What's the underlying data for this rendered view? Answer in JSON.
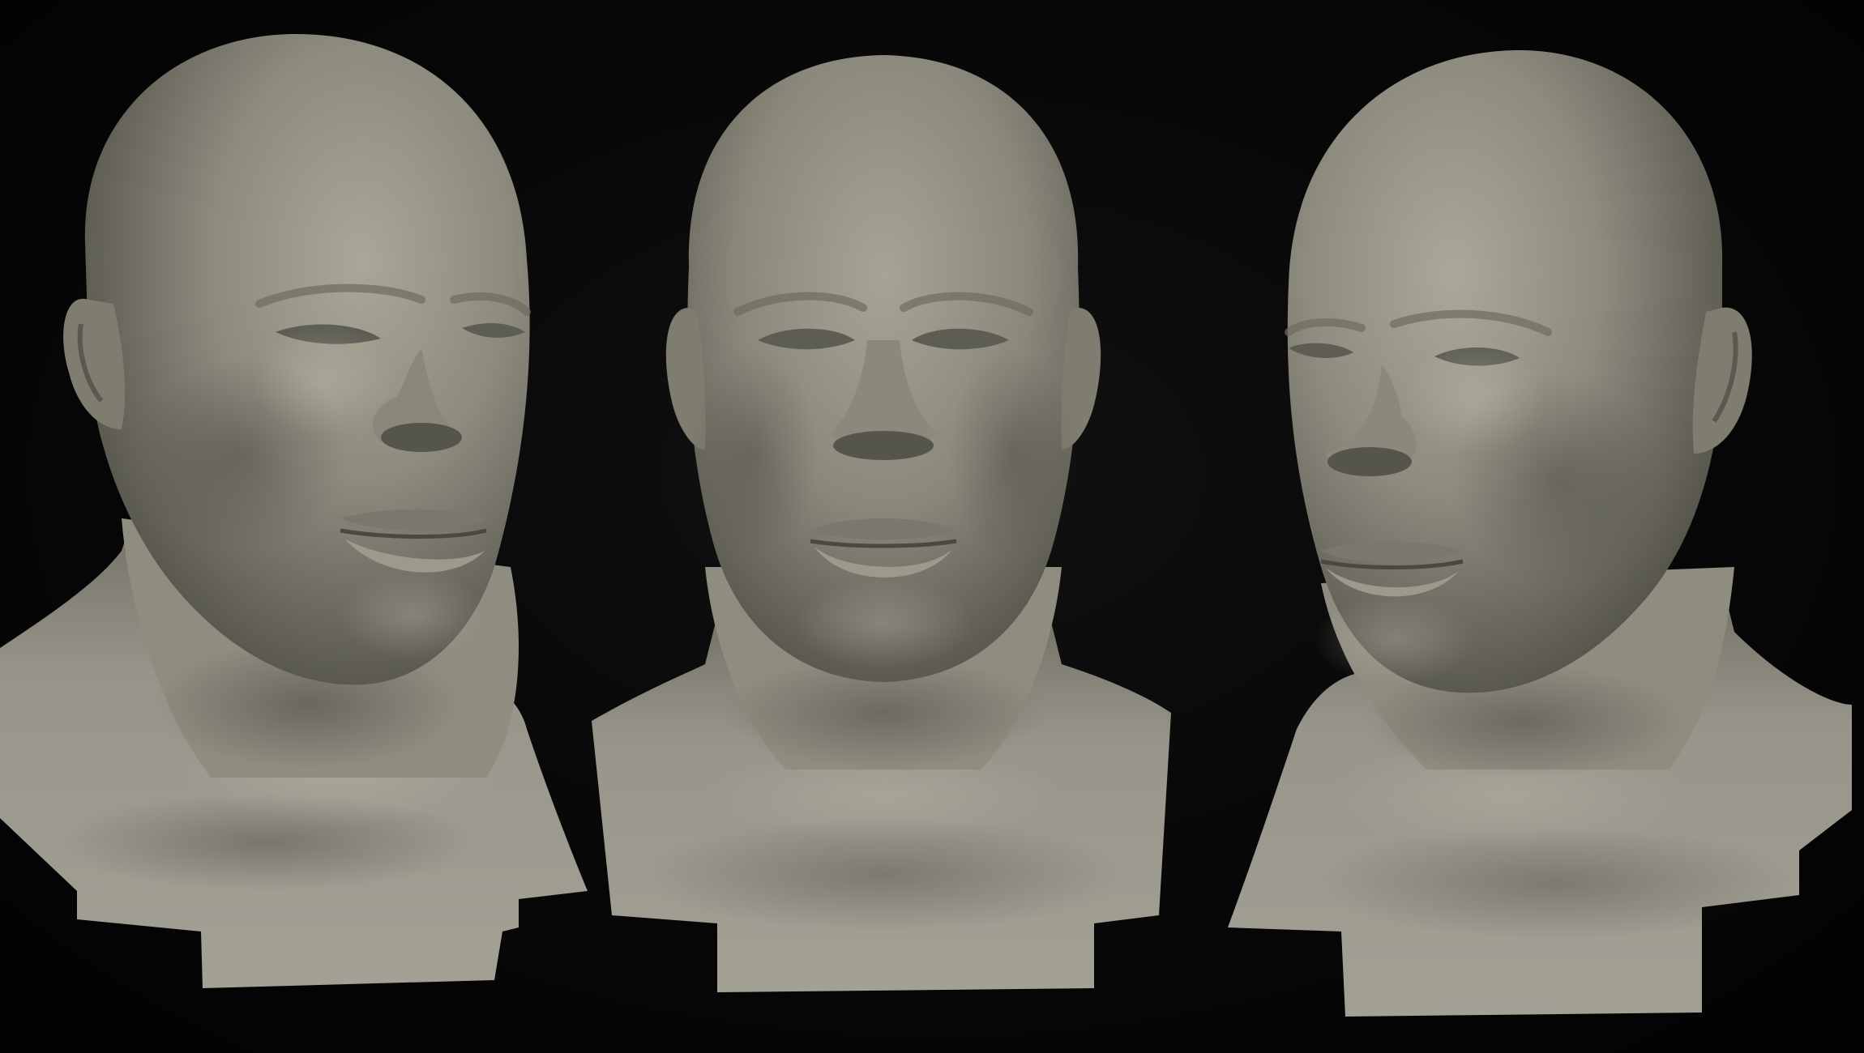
{
  "scene": {
    "background_color": "#050505",
    "sculpt_color": "#8a887b",
    "views": [
      {
        "id": "three-quarter-left",
        "label_icon": "sculpted-bust-icon"
      },
      {
        "id": "front",
        "label_icon": "sculpted-bust-icon"
      },
      {
        "id": "three-quarter-right",
        "label_icon": "sculpted-bust-icon"
      }
    ]
  }
}
